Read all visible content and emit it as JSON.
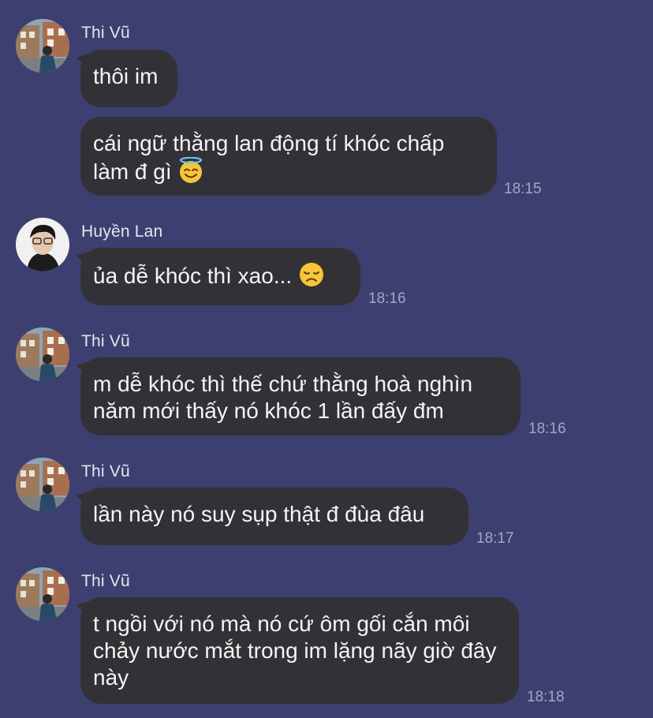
{
  "colors": {
    "background": "#3d3f70",
    "bubble": "#323236",
    "text": "#f4f4f4",
    "sender": "#e6e6ee",
    "timestamp": "#a3a6c2"
  },
  "messages": [
    {
      "sender": "Thi Vũ",
      "text": "thôi im"
    },
    {
      "text": "cái ngữ thằng lan động tí khóc chấp làm đ gì",
      "emoji": "smiling-face-with-halo-icon",
      "time": "18:15"
    },
    {
      "sender": "Huyền Lan",
      "text": "ủa dễ khóc thì xao...",
      "emoji": "disappointed-face-icon",
      "time": "18:16"
    },
    {
      "sender": "Thi Vũ",
      "text": "m dễ khóc thì thế chứ thằng hoà nghìn năm mới thấy nó khóc 1 lần đấy đm",
      "time": "18:16"
    },
    {
      "sender": "Thi Vũ",
      "text": "lần này nó suy sụp thật đ đùa đâu",
      "time": "18:17"
    },
    {
      "sender": "Thi Vũ",
      "text": "t ngồi với nó mà nó cứ ôm gối cắn môi chảy nước mắt trong im lặng nãy giờ đây này",
      "time": "18:18"
    }
  ]
}
